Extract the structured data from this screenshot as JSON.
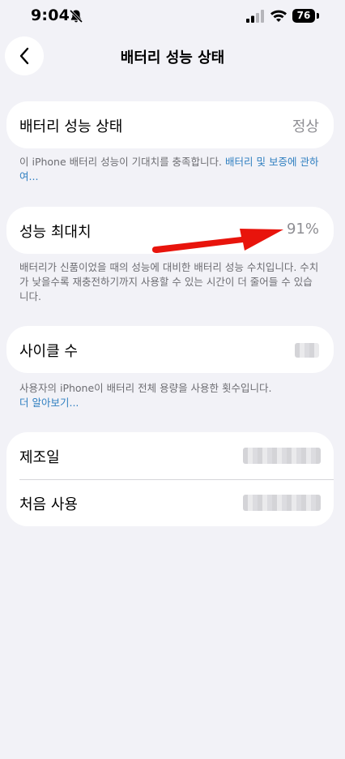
{
  "status_bar": {
    "time": "9:04",
    "battery": "76"
  },
  "header": {
    "title": "배터리 성능 상태"
  },
  "battery_health": {
    "label": "배터리 성능 상태",
    "value": "정상",
    "note": "이 iPhone 배터리 성능이 기대치를 충족합니다.",
    "link": "배터리 및 보증에 관하여..."
  },
  "max_capacity": {
    "label": "성능 최대치",
    "value": "91%",
    "note": "배터리가 신품이었을 때의 성능에 대비한 배터리 성능 수치입니다. 수치가 낮을수록 재충전하기까지 사용할 수 있는 시간이 더 줄어들 수 있습니다."
  },
  "cycle_count": {
    "label": "사이클 수",
    "note": "사용자의 iPhone이 배터리 전체 용량을 사용한 횟수입니다.",
    "link": "더 알아보기..."
  },
  "dates": {
    "manufacture_label": "제조일",
    "first_use_label": "처음 사용"
  },
  "colors": {
    "background": "#f2f2f7",
    "link": "#2f7fc0",
    "annotation_arrow": "#e8140c"
  }
}
